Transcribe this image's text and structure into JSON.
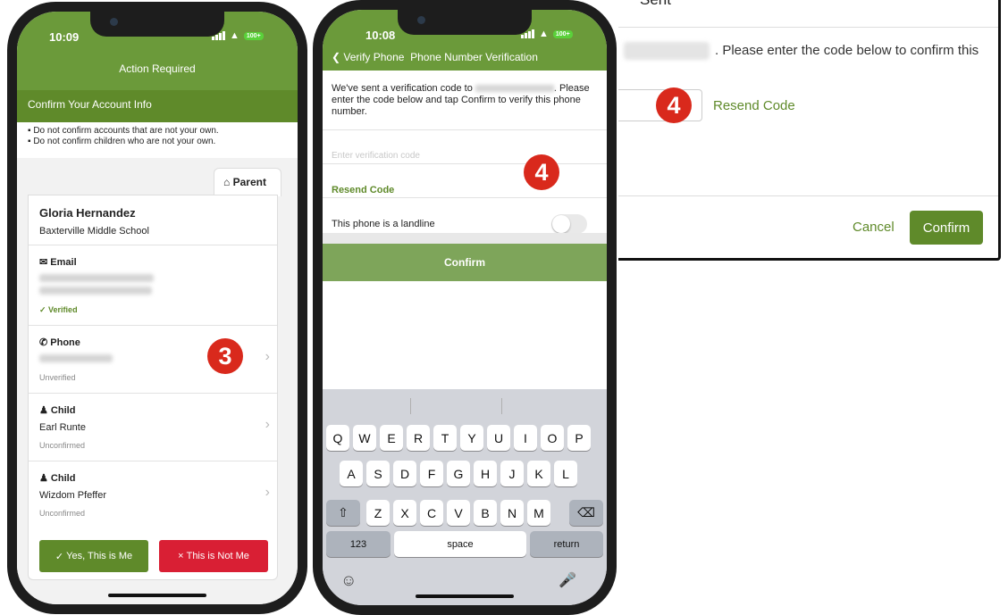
{
  "dialog": {
    "title": "Sent",
    "message": ". Please enter the code below to confirm this",
    "resend_label": "Resend Code",
    "cancel_label": "Cancel",
    "confirm_label": "Confirm",
    "step_badge": "4"
  },
  "phone1": {
    "time": "10:09",
    "battery": "100+",
    "header_title": "Action Required",
    "section_title": "Confirm Your Account Info",
    "rules": [
      "Do not confirm accounts that are not your own.",
      "Do not confirm children who are not your own."
    ],
    "role_tab": "Parent",
    "account": {
      "name": "Gloria Hernandez",
      "school": "Baxterville Middle School"
    },
    "email": {
      "label": "Email",
      "status": "Verified"
    },
    "phone": {
      "label": "Phone",
      "status": "Unverified"
    },
    "children": [
      {
        "label": "Child",
        "name": "Earl Runte",
        "status": "Unconfirmed"
      },
      {
        "label": "Child",
        "name": "Wizdom Pfeffer",
        "status": "Unconfirmed"
      }
    ],
    "yes_label": "Yes, This is Me",
    "no_label": "This is Not Me",
    "step_badge": "3"
  },
  "phone2": {
    "time": "10:08",
    "battery": "100+",
    "back_label": "Verify Phone",
    "nav_title": "Phone Number Verification",
    "intro_a": "We've sent a verification code to",
    "intro_b": ". Please enter the code below and tap Confirm to verify this phone number.",
    "code_placeholder": "Enter verification code",
    "resend_label": "Resend Code",
    "landline_label": "This phone is a landline",
    "confirm_label": "Confirm",
    "step_badge": "4",
    "keyboard": {
      "row1": [
        "Q",
        "W",
        "E",
        "R",
        "T",
        "Y",
        "U",
        "I",
        "O",
        "P"
      ],
      "row2": [
        "A",
        "S",
        "D",
        "F",
        "G",
        "H",
        "J",
        "K",
        "L"
      ],
      "row3": [
        "Z",
        "X",
        "C",
        "V",
        "B",
        "N",
        "M"
      ],
      "numbers_key": "123",
      "space_key": "space",
      "return_key": "return"
    }
  }
}
